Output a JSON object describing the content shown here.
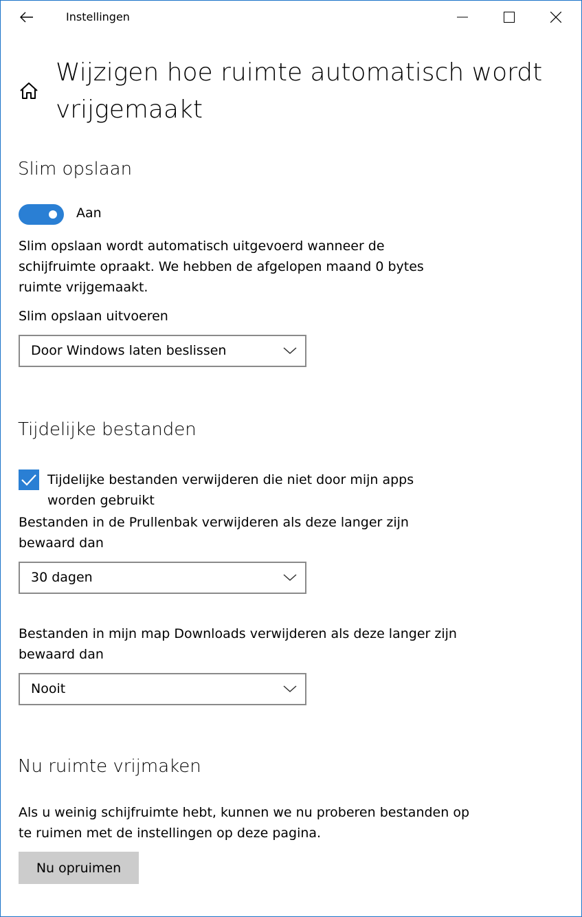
{
  "window": {
    "title": "Instellingen",
    "back_icon": "back-arrow-icon",
    "controls": [
      "minimize-icon",
      "maximize-icon",
      "close-icon"
    ]
  },
  "page": {
    "home_icon": "home-icon",
    "title": "Wijzigen hoe ruimte automatisch wordt vrijgemaakt"
  },
  "storage_sense": {
    "heading": "Slim opslaan",
    "toggle_state": "on",
    "toggle_label": "Aan",
    "description": "Slim opslaan wordt automatisch uitgevoerd wanneer de schijfruimte opraakt. We hebben de afgelopen maand 0 bytes ruimte vrijgemaakt.",
    "run_label": "Slim opslaan uitvoeren",
    "run_value": "Door Windows laten beslissen"
  },
  "temp_files": {
    "heading": "Tijdelijke bestanden",
    "checkbox_checked": true,
    "checkbox_label": "Tijdelijke bestanden verwijderen die niet door mijn apps worden gebruikt",
    "recycle_label": "Bestanden in de Prullenbak verwijderen als deze langer zijn bewaard dan",
    "recycle_value": "30 dagen",
    "downloads_label": "Bestanden in mijn map Downloads verwijderen als deze langer zijn bewaard dan",
    "downloads_value": "Nooit"
  },
  "free_now": {
    "heading": "Nu ruimte vrijmaken",
    "description": "Als u weinig schijfruimte hebt, kunnen we nu proberen bestanden op te ruimen met de instellingen op deze pagina.",
    "button_label": "Nu opruimen"
  },
  "colors": {
    "accent": "#2a7fd4",
    "window_border": "#1a73c9",
    "button_bg": "#cccccc",
    "dropdown_border": "#8a8a8a"
  }
}
